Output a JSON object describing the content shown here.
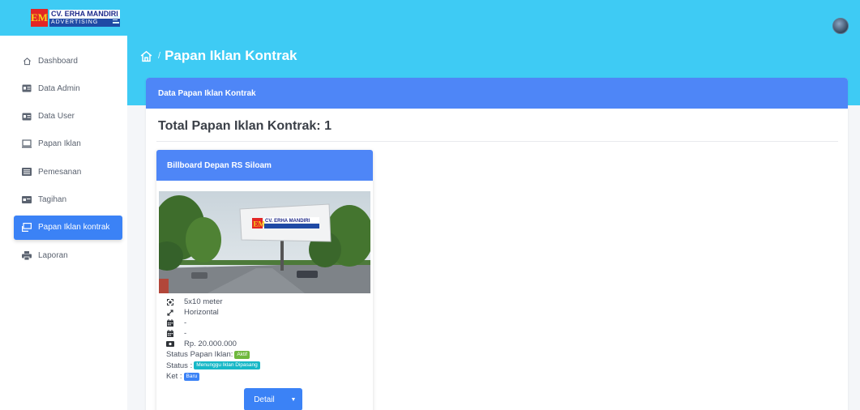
{
  "brand": {
    "logo_mark": "EM",
    "logo_name": "CV. ERHA MANDIRI",
    "logo_sub": "ADVERTISING"
  },
  "sidebar": {
    "items": [
      {
        "label": "Dashboard",
        "icon": "home-icon",
        "active": false
      },
      {
        "label": "Data Admin",
        "icon": "id-card-icon",
        "active": false
      },
      {
        "label": "Data User",
        "icon": "id-card-icon",
        "active": false
      },
      {
        "label": "Papan Iklan",
        "icon": "monitor-icon",
        "active": false
      },
      {
        "label": "Pemesanan",
        "icon": "list-icon",
        "active": false
      },
      {
        "label": "Tagihan",
        "icon": "card-icon",
        "active": false
      },
      {
        "label": "Papan Iklan kontrak",
        "icon": "billboard-icon",
        "active": true
      },
      {
        "label": "Laporan",
        "icon": "print-icon",
        "active": false
      }
    ]
  },
  "breadcrumb": {
    "separator": "/",
    "title": "Papan Iklan Kontrak"
  },
  "card": {
    "header": "Data Papan Iklan Kontrak",
    "total_label": "Total Papan Iklan Kontrak: 1"
  },
  "billboard": {
    "title": "Billboard Depan RS Siloam",
    "size": "5x10 meter",
    "orientation": "Horizontal",
    "date_start": "-",
    "date_end": "-",
    "price": "Rp. 20.000.000",
    "status_papan_label": "Status Papan Iklan:",
    "status_papan_value": "Aktif",
    "status_label": "Status :",
    "status_value": "Menunggu Iklan Dipasang",
    "ket_label": "Ket :",
    "ket_value": "Baru",
    "detail_button": "Detail"
  },
  "colors": {
    "topbar": "#3ecbf4",
    "primary": "#3b82f6",
    "card_header": "#4e86f7",
    "badge_green": "#6fb83d",
    "badge_teal": "#17b8c7"
  }
}
